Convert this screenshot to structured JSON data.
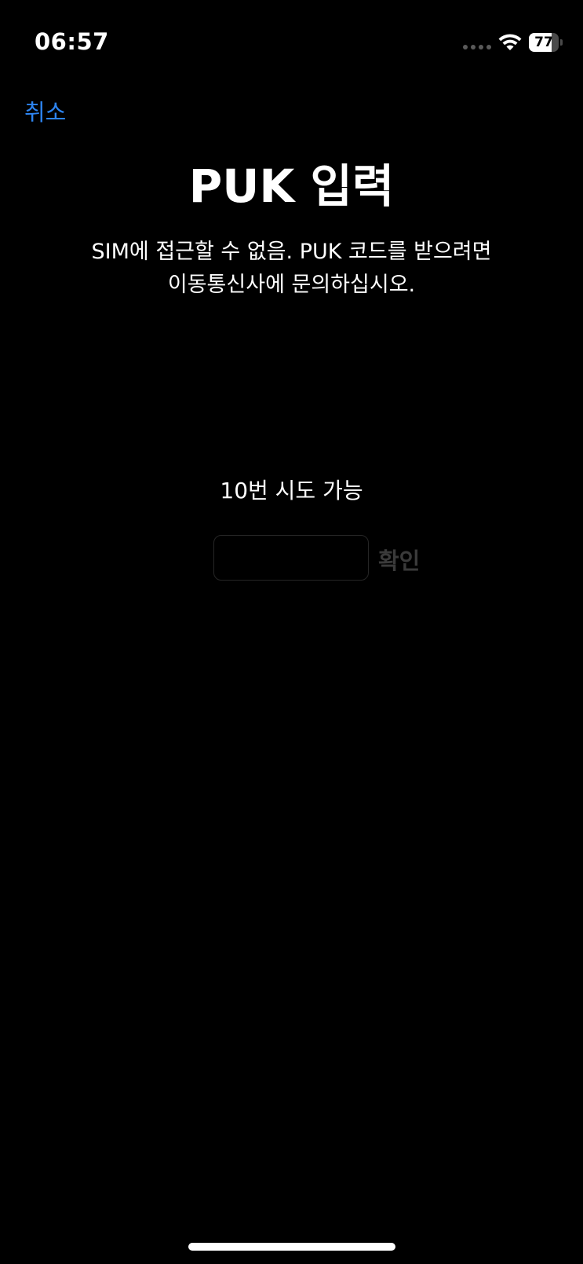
{
  "status_bar": {
    "time": "06:57",
    "battery_level": "77",
    "battery_fraction": 0.77,
    "wifi_icon": "wifi-icon",
    "signal_icon": "cellular-signal-dots-icon"
  },
  "nav": {
    "cancel_label": "취소"
  },
  "title": "PUK 입력",
  "description": {
    "line1": "SIM에 접근할 수 없음. PUK 코드를 받으려면",
    "line2": "이동통신사에 문의하십시오."
  },
  "attempts_label": "10번 시도 가능",
  "input": {
    "value": "",
    "placeholder": ""
  },
  "confirm_label": "확인",
  "colors": {
    "background": "#000000",
    "accent": "#2d84f0",
    "disabled": "#3a3a3a",
    "text": "#ffffff"
  }
}
